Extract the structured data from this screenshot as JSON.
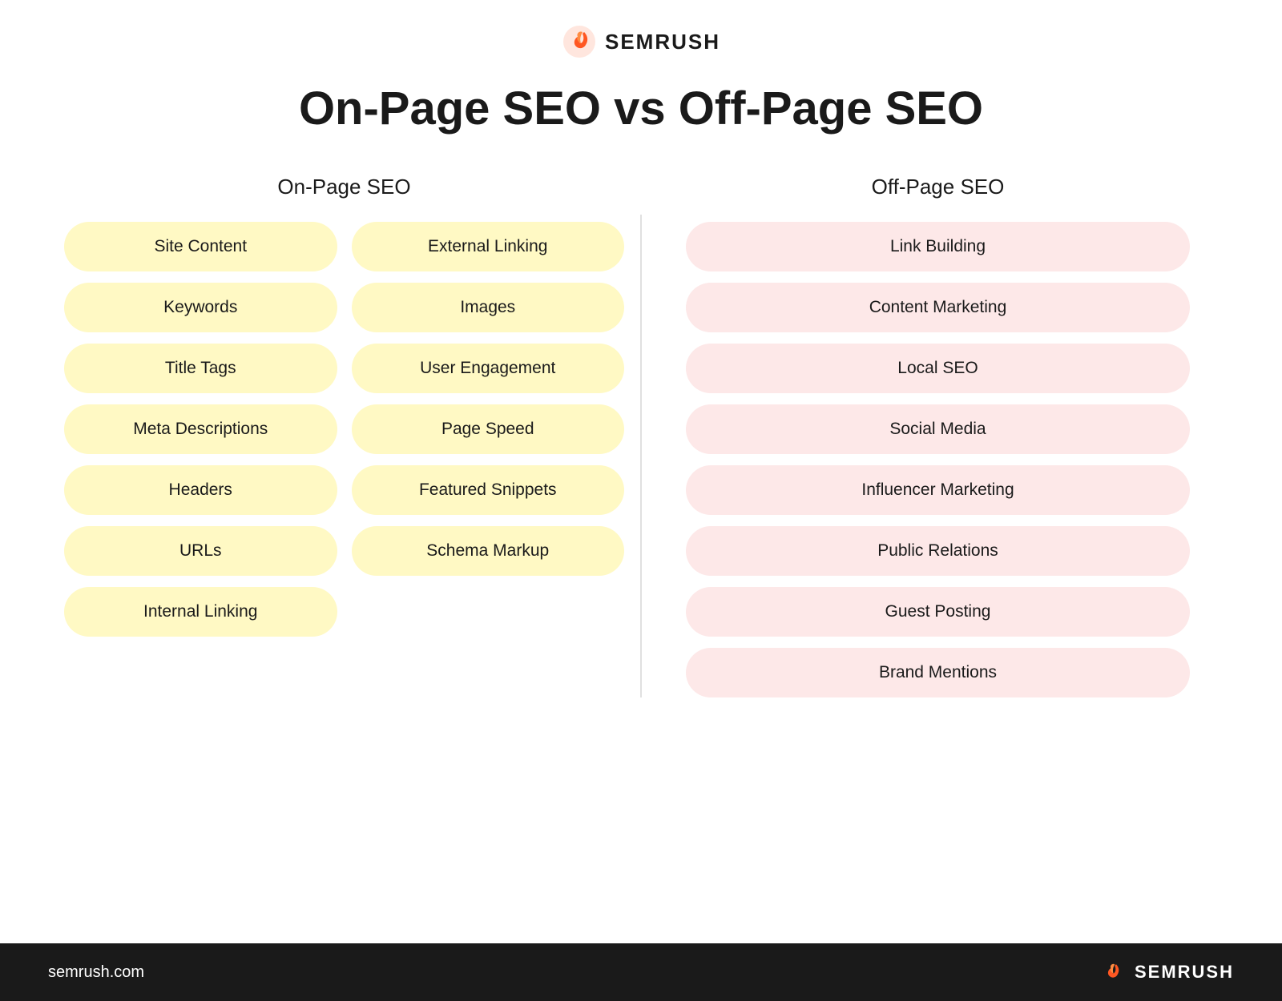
{
  "header": {
    "logo_text": "SEMRUSH",
    "page_title": "On-Page SEO vs Off-Page SEO"
  },
  "on_page_column": {
    "title": "On-Page SEO",
    "col1_items": [
      "Site Content",
      "Keywords",
      "Title Tags",
      "Meta Descriptions",
      "Headers",
      "URLs",
      "Internal Linking"
    ],
    "col2_items": [
      "External Linking",
      "Images",
      "User Engagement",
      "Page Speed",
      "Featured Snippets",
      "Schema Markup"
    ]
  },
  "off_page_column": {
    "title": "Off-Page SEO",
    "items": [
      "Link Building",
      "Content Marketing",
      "Local SEO",
      "Social Media",
      "Influencer Marketing",
      "Public Relations",
      "Guest Posting",
      "Brand Mentions"
    ]
  },
  "footer": {
    "url": "semrush.com",
    "logo_text": "SEMRUSH"
  }
}
